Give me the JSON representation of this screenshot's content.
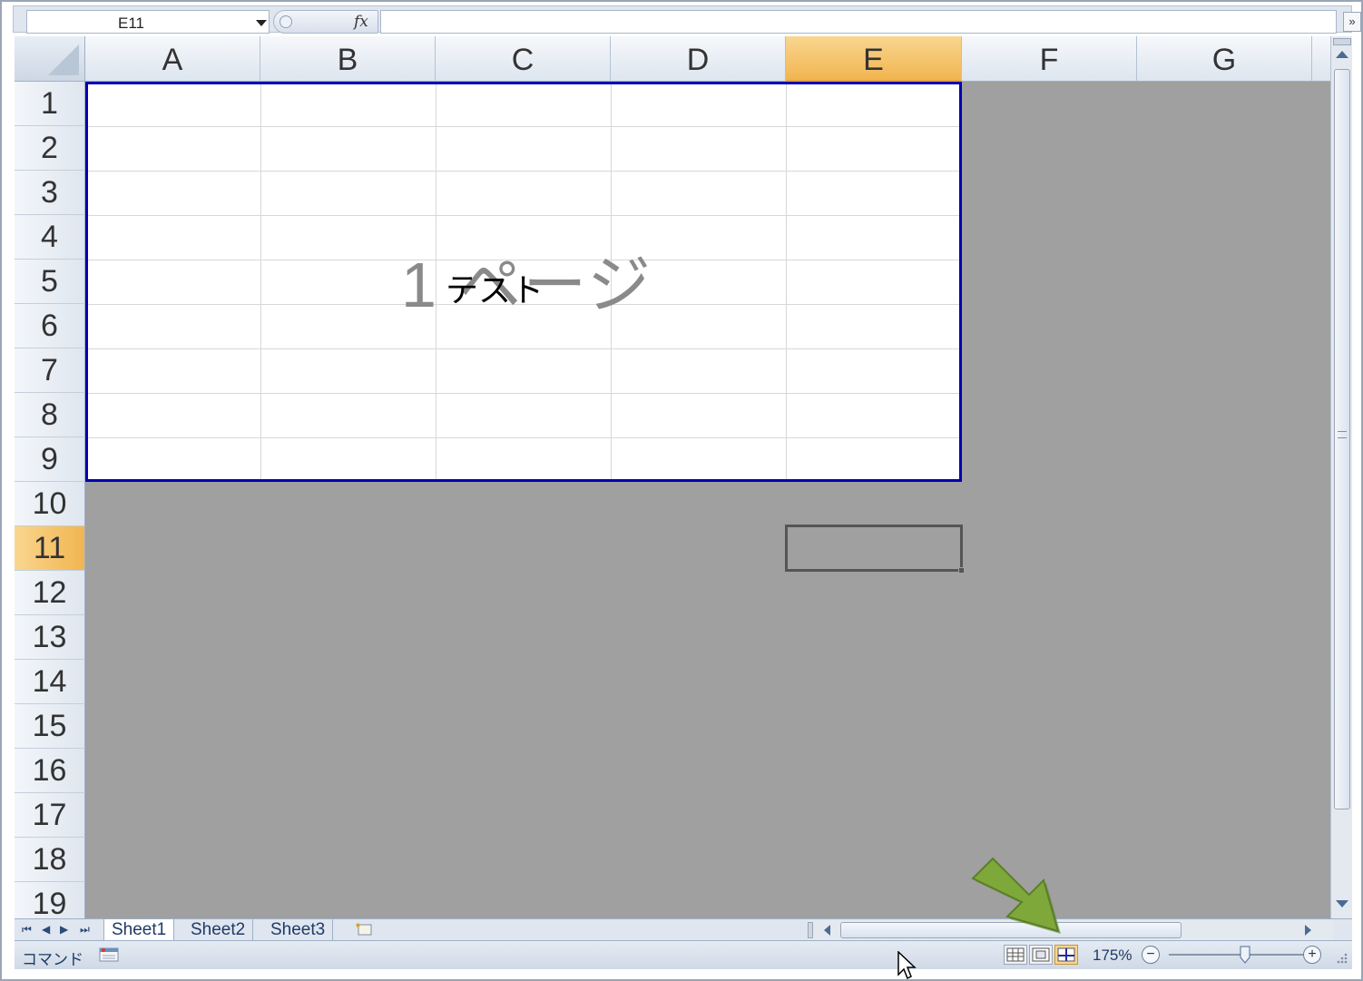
{
  "formula_bar": {
    "name_box": "E11",
    "fx": "fx",
    "formula": ""
  },
  "columns": [
    {
      "label": "A",
      "selected": false
    },
    {
      "label": "B",
      "selected": false
    },
    {
      "label": "C",
      "selected": false
    },
    {
      "label": "D",
      "selected": false
    },
    {
      "label": "E",
      "selected": true
    },
    {
      "label": "F",
      "selected": false
    },
    {
      "label": "G",
      "selected": false
    }
  ],
  "rows": [
    "1",
    "2",
    "3",
    "4",
    "5",
    "6",
    "7",
    "8",
    "9",
    "10",
    "11",
    "12",
    "13",
    "14",
    "15",
    "16",
    "17",
    "18",
    "19"
  ],
  "selected_row": "11",
  "page_watermark": "1 ページ",
  "cells": {
    "B5": "テスト"
  },
  "sheet_tabs": [
    "Sheet1",
    "Sheet2",
    "Sheet3"
  ],
  "active_sheet": "Sheet1",
  "status_bar": {
    "mode": "コマンド",
    "zoom": "175%",
    "active_view": "page-break-preview"
  },
  "colors": {
    "selection_header": "#f1b550",
    "page_border": "#0000b0",
    "annotation_arrow": "#7fa83a"
  }
}
